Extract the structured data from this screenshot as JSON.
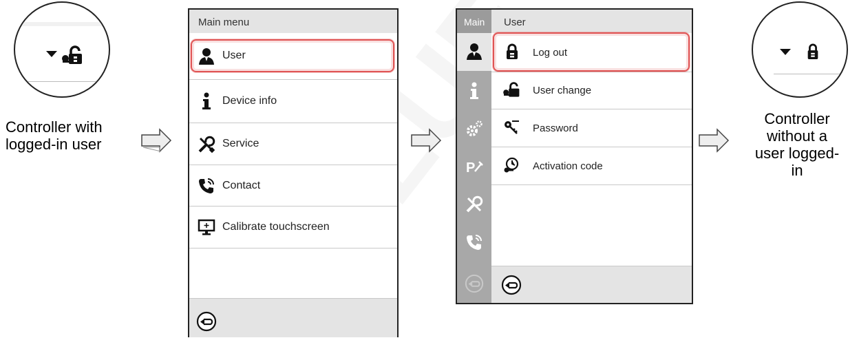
{
  "left_callout": {
    "caption_line1": "Controller with",
    "caption_line2": "logged-in user"
  },
  "right_callout": {
    "caption_line1": "Controller",
    "caption_line2": "without a",
    "caption_line3": "user logged-",
    "caption_line4": "in"
  },
  "main_menu": {
    "title": "Main menu",
    "items": [
      {
        "label": "User",
        "icon": "user-icon"
      },
      {
        "label": "Device info",
        "icon": "info-icon"
      },
      {
        "label": "Service",
        "icon": "tools-icon"
      },
      {
        "label": "Contact",
        "icon": "phone-icon"
      },
      {
        "label": "Calibrate touchscreen",
        "icon": "touchscreen-icon"
      }
    ]
  },
  "user_menu": {
    "breadcrumb_root": "Main",
    "title": "User",
    "items": [
      {
        "label": "Log out",
        "icon": "lock-icon"
      },
      {
        "label": "User change",
        "icon": "user-key-icon"
      },
      {
        "label": "Password",
        "icon": "key-icon"
      },
      {
        "label": "Activation code",
        "icon": "activation-icon"
      }
    ],
    "sidebar": [
      "user-icon",
      "info-icon",
      "settings-icon",
      "program-icon",
      "tools-icon",
      "phone-icon"
    ]
  },
  "colors": {
    "selection": "#e05555",
    "header": "#e4e4e4",
    "sidebar": "#a8a8a8"
  }
}
